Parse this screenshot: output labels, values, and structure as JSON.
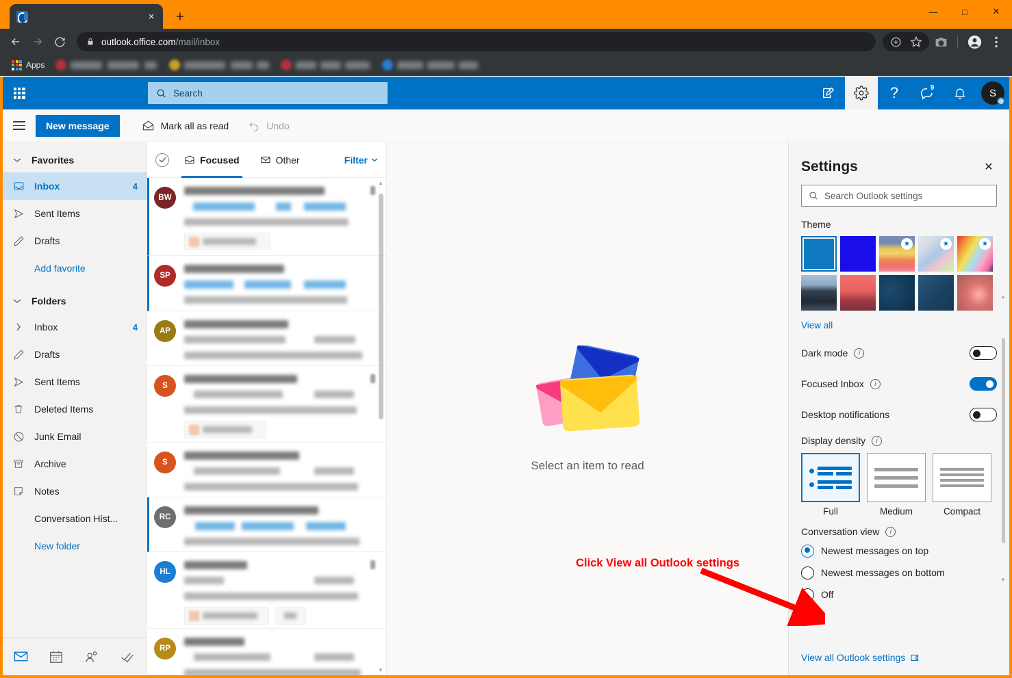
{
  "browser": {
    "tab_title": "",
    "new_tab_label": "+",
    "close_tab_label": "×",
    "url_domain": "outlook.office.com",
    "url_path": "/mail/inbox",
    "bookmarks_apps_label": "Apps",
    "window": {
      "minimize": "—",
      "maximize": "□",
      "close": "✕"
    },
    "nav": {
      "back": "←",
      "forward": "→",
      "reload": "↻"
    }
  },
  "topbar": {
    "search_placeholder": "Search",
    "chat_badge": "9",
    "avatar_initial": "S"
  },
  "commandbar": {
    "new_message": "New message",
    "mark_all_as_read": "Mark all as read",
    "undo": "Undo"
  },
  "folders": {
    "favorites_group": "Favorites",
    "folders_group": "Folders",
    "favorites": [
      {
        "label": "Inbox",
        "count": "4",
        "icon": "inbox-icon",
        "selected": true
      },
      {
        "label": "Sent Items",
        "count": "",
        "icon": "sent-icon",
        "selected": false
      },
      {
        "label": "Drafts",
        "count": "",
        "icon": "drafts-icon",
        "selected": false
      },
      {
        "label": "Add favorite",
        "count": "",
        "icon": "",
        "selected": false,
        "link": true
      }
    ],
    "items": [
      {
        "label": "Inbox",
        "count": "4",
        "icon": "chevron-right-icon"
      },
      {
        "label": "Drafts",
        "count": "",
        "icon": "drafts-icon"
      },
      {
        "label": "Sent Items",
        "count": "",
        "icon": "sent-icon"
      },
      {
        "label": "Deleted Items",
        "count": "",
        "icon": "trash-icon"
      },
      {
        "label": "Junk Email",
        "count": "",
        "icon": "block-icon"
      },
      {
        "label": "Archive",
        "count": "",
        "icon": "archive-icon"
      },
      {
        "label": "Notes",
        "count": "",
        "icon": "note-icon"
      },
      {
        "label": "Conversation Hist...",
        "count": "",
        "icon": ""
      },
      {
        "label": "New folder",
        "count": "",
        "icon": "",
        "link": true
      }
    ],
    "appbar": [
      {
        "name": "mail-icon",
        "active": true
      },
      {
        "name": "calendar-icon",
        "active": false
      },
      {
        "name": "people-icon",
        "active": false
      },
      {
        "name": "todo-icon",
        "active": false
      }
    ]
  },
  "messagelist": {
    "focused_tab": "Focused",
    "other_tab": "Other",
    "filter": "Filter",
    "rows": [
      {
        "initials": "BW",
        "color": "#7b2326",
        "unread": true,
        "attachment": true,
        "pin": true
      },
      {
        "initials": "SP",
        "color": "#b02a27",
        "unread": true,
        "attachment": false,
        "pin": false
      },
      {
        "initials": "AP",
        "color": "#9a7b12",
        "unread": false,
        "attachment": false,
        "pin": false
      },
      {
        "initials": "S",
        "color": "#d9531e",
        "unread": false,
        "attachment": true,
        "pin": true
      },
      {
        "initials": "S",
        "color": "#d9531e",
        "unread": false,
        "attachment": false,
        "pin": false
      },
      {
        "initials": "RC",
        "color": "#6e6e6e",
        "unread": true,
        "attachment": false,
        "pin": false
      },
      {
        "initials": "HL",
        "color": "#1a7fd4",
        "unread": false,
        "attachment": true,
        "pin": true
      },
      {
        "initials": "RP",
        "color": "#b88a16",
        "unread": false,
        "attachment": false,
        "pin": false
      }
    ]
  },
  "reading_pane": {
    "empty_message": "Select an item to read"
  },
  "settings": {
    "title": "Settings",
    "close_label": "✕",
    "search_placeholder": "Search Outlook settings",
    "theme_label": "Theme",
    "themes": [
      {
        "name": "solid-blue",
        "selected": true,
        "premium": false
      },
      {
        "name": "solid-deep-blue",
        "selected": false,
        "premium": false
      },
      {
        "name": "sunrise-stripes",
        "selected": false,
        "premium": true
      },
      {
        "name": "pastel-swirl",
        "selected": false,
        "premium": true
      },
      {
        "name": "unicorn-rainbow",
        "selected": false,
        "premium": true
      },
      {
        "name": "mountain-road",
        "selected": false,
        "premium": false
      },
      {
        "name": "palm-sunset",
        "selected": false,
        "premium": false
      },
      {
        "name": "circuit-board",
        "selected": false,
        "premium": false
      },
      {
        "name": "innovation-blue",
        "selected": false,
        "premium": false
      },
      {
        "name": "red-glow",
        "selected": false,
        "premium": false
      }
    ],
    "view_all_themes": "View all",
    "dark_mode_label": "Dark mode",
    "dark_mode_on": false,
    "focused_inbox_label": "Focused Inbox",
    "focused_inbox_on": true,
    "desktop_notifications_label": "Desktop notifications",
    "desktop_notifications_on": false,
    "display_density_label": "Display density",
    "density_options": [
      {
        "label": "Full",
        "selected": true
      },
      {
        "label": "Medium",
        "selected": false
      },
      {
        "label": "Compact",
        "selected": false
      }
    ],
    "conversation_view_label": "Conversation view",
    "conversation_options": [
      {
        "label": "Newest messages on top",
        "selected": true
      },
      {
        "label": "Newest messages on bottom",
        "selected": false
      },
      {
        "label": "Off",
        "selected": false
      }
    ],
    "view_all_settings": "View all Outlook settings"
  },
  "annotation": {
    "text": "Click View all Outlook settings",
    "color": "#ff0000"
  }
}
